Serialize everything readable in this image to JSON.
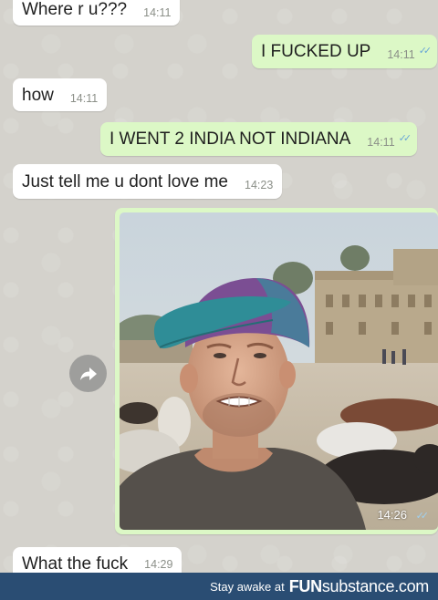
{
  "messages": [
    {
      "text": "Where r u???",
      "time": "14:11"
    },
    {
      "text": "I FUCKED UP",
      "time": "14:11",
      "ticks": "✓✓"
    },
    {
      "text": "how",
      "time": "14:11"
    },
    {
      "text": "I WENT 2 INDIA NOT INDIANA",
      "time": "14:11",
      "ticks": "✓✓"
    },
    {
      "text": "Just tell me u dont love me",
      "time": "14:23"
    },
    {
      "text": "What the fuck",
      "time": "14:29"
    }
  ],
  "photo_message": {
    "time": "14:26",
    "ticks": "✓✓"
  },
  "icons": {
    "forward": "forward-arrow-icon",
    "read_receipt": "double-check-icon"
  },
  "colors": {
    "incoming": "#ffffff",
    "outgoing": "#dcf8c6",
    "footer": "#2a4d73",
    "ticks": "#6aa7d6"
  },
  "footer": {
    "tagline": "Stay awake at",
    "brand_bold": "FUN",
    "brand_rest": "substance",
    "brand_tld": ".com"
  }
}
